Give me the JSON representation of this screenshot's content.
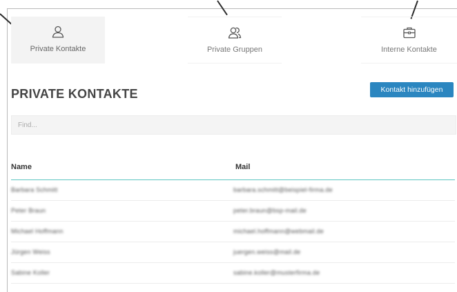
{
  "tabs": [
    {
      "label": "Private Kontakte",
      "icon": "user-icon",
      "active": true
    },
    {
      "label": "Private Gruppen",
      "icon": "users-icon",
      "active": false
    },
    {
      "label": "Interne Kontakte",
      "icon": "briefcase-icon",
      "active": false
    }
  ],
  "page": {
    "title": "PRIVATE KONTAKTE",
    "add_button_label": "Kontakt hinzufügen",
    "search_placeholder": "Find..."
  },
  "table": {
    "columns": [
      "Name",
      "Mail"
    ],
    "rows": [
      {
        "name": "Barbara Schmitt",
        "mail": "barbara.schmitt@beispiel-firma.de"
      },
      {
        "name": "Peter Braun",
        "mail": "peter.braun@bsp-mail.de"
      },
      {
        "name": "Michael Hoffmann",
        "mail": "michael.hoffmann@webmail.de"
      },
      {
        "name": "Jürgen Weiss",
        "mail": "juergen.weiss@mail.de"
      },
      {
        "name": "Sabine Koller",
        "mail": "sabine.koller@musterfirma.de"
      }
    ]
  },
  "colors": {
    "accent": "#2b86c0",
    "table_rule": "#5cc4c0",
    "active_tab_bg": "#f3f3f3"
  }
}
